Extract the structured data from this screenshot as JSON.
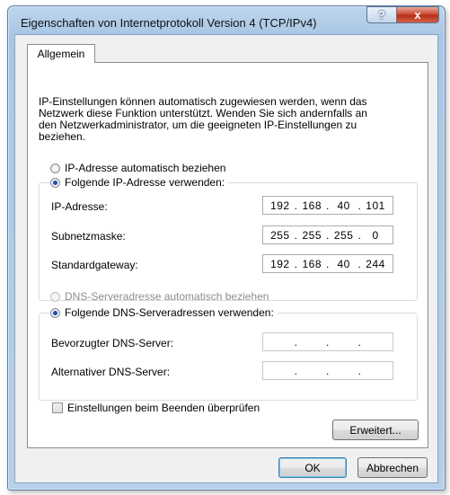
{
  "window": {
    "title": "Eigenschaften von Internetprotokoll Version 4 (TCP/IPv4)",
    "help_glyph": "?",
    "close_glyph": "x"
  },
  "tabs": [
    {
      "label": "Allgemein",
      "active": true
    }
  ],
  "description": [
    "IP-Einstellungen können automatisch zugewiesen werden, wenn das",
    "Netzwerk diese Funktion unterstützt. Wenden Sie sich andernfalls an",
    "den Netzwerkadministrator, um die geeigneten IP-Einstellungen zu",
    "beziehen."
  ],
  "ip": {
    "auto_label": "IP-Adresse automatisch beziehen",
    "manual_label": "Folgende IP-Adresse verwenden:",
    "selected": "manual",
    "fields": [
      {
        "label": "IP-Adresse:",
        "octets": [
          "192",
          "168",
          "40",
          "101"
        ]
      },
      {
        "label": "Subnetzmaske:",
        "octets": [
          "255",
          "255",
          "255",
          "0"
        ]
      },
      {
        "label": "Standardgateway:",
        "octets": [
          "192",
          "168",
          "40",
          "244"
        ]
      }
    ]
  },
  "dns": {
    "auto_label": "DNS-Serveradresse automatisch beziehen",
    "auto_disabled": true,
    "manual_label": "Folgende DNS-Serveradressen verwenden:",
    "selected": "manual",
    "fields": [
      {
        "label": "Bevorzugter DNS-Server:",
        "octets": [
          "",
          "",
          "",
          ""
        ]
      },
      {
        "label": "Alternativer DNS-Server:",
        "octets": [
          "",
          "",
          "",
          ""
        ]
      }
    ]
  },
  "validate_checkbox": {
    "label": "Einstellungen beim Beenden überprüfen",
    "checked": false
  },
  "buttons": {
    "advanced": "Erweitert...",
    "ok": "OK",
    "cancel": "Abbrechen"
  },
  "dot": "."
}
